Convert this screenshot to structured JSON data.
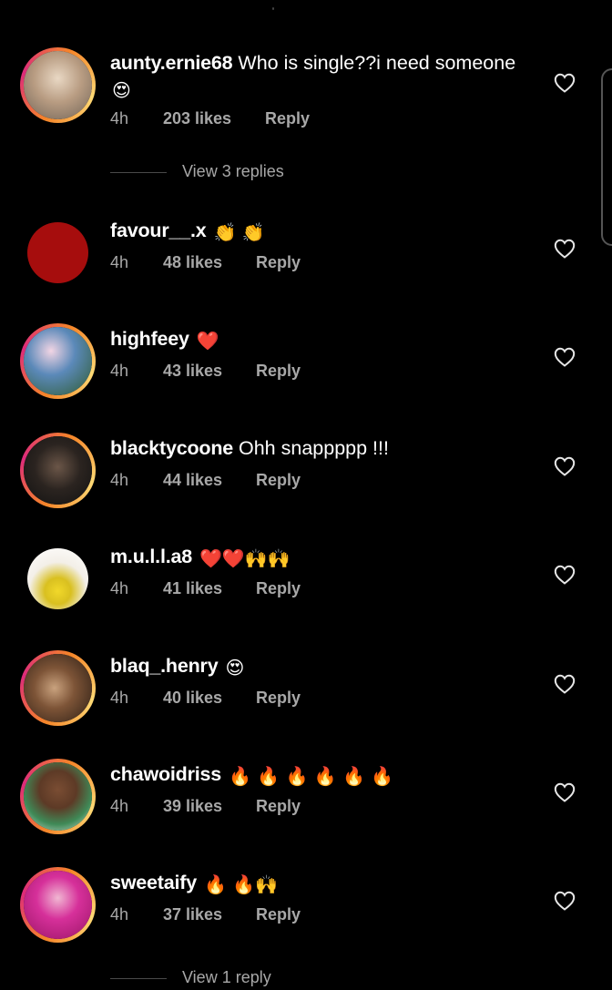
{
  "comments": [
    {
      "username": "aunty.ernie68",
      "text": "Who is single??i need someone",
      "emoji_line2": "😍",
      "time": "4h",
      "likes": "203 likes",
      "reply": "Reply",
      "avatar_color": "#c9b7a0"
    },
    {
      "username": "favour__.x",
      "text": "",
      "emoji": "👏 👏",
      "time": "4h",
      "likes": "48 likes",
      "reply": "Reply",
      "avatar_color": "#a60d0d"
    },
    {
      "username": "highfeey",
      "text": "",
      "emoji": "❤️",
      "time": "4h",
      "likes": "43 likes",
      "reply": "Reply",
      "avatar_color": "#6b9cc4"
    },
    {
      "username": "blacktycoone",
      "text": "Ohh snappppp !!!",
      "emoji": "",
      "time": "4h",
      "likes": "44 likes",
      "reply": "Reply",
      "avatar_color": "#2a2a2a"
    },
    {
      "username": "m.u.l.l.a8",
      "text": "",
      "emoji": "❤️❤️🙌🙌",
      "time": "4h",
      "likes": "41 likes",
      "reply": "Reply",
      "avatar_color": "#e8e0d0"
    },
    {
      "username": "blaq_.henry",
      "text": "",
      "emoji": "😍",
      "time": "4h",
      "likes": "40 likes",
      "reply": "Reply",
      "avatar_color": "#6e4a33"
    },
    {
      "username": "chawoidriss",
      "text": "",
      "emoji": "🔥 🔥 🔥 🔥 🔥 🔥",
      "time": "4h",
      "likes": "39 likes",
      "reply": "Reply",
      "avatar_color": "#4c8a5a"
    },
    {
      "username": "sweetaify",
      "text": "",
      "emoji": "🔥 🔥🙌",
      "time": "4h",
      "likes": "37 likes",
      "reply": "Reply",
      "avatar_color": "#d6309a"
    }
  ],
  "view_replies_1": "View 3 replies",
  "view_replies_2": "View 1 reply",
  "icons": {
    "like": "heart-outline-icon"
  }
}
